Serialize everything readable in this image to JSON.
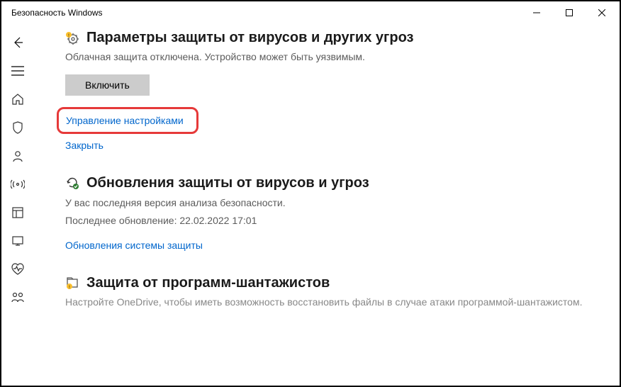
{
  "window": {
    "title": "Безопасность Windows"
  },
  "sections": {
    "protection_settings": {
      "title": "Параметры защиты от вирусов и других угроз",
      "desc": "Облачная защита отключена. Устройство может быть уязвимым.",
      "enable_btn": "Включить",
      "manage_link": "Управление настройками",
      "close_link": "Закрыть"
    },
    "updates": {
      "title": "Обновления защиты от вирусов и угроз",
      "line1": "У вас последняя версия анализа безопасности.",
      "line2": "Последнее обновление: 22.02.2022 17:01",
      "link": "Обновления системы защиты"
    },
    "ransomware": {
      "title": "Защита от программ-шантажистов",
      "desc": "Настройте OneDrive, чтобы иметь возможность восстановить файлы в случае атаки программой-шантажистом."
    }
  }
}
